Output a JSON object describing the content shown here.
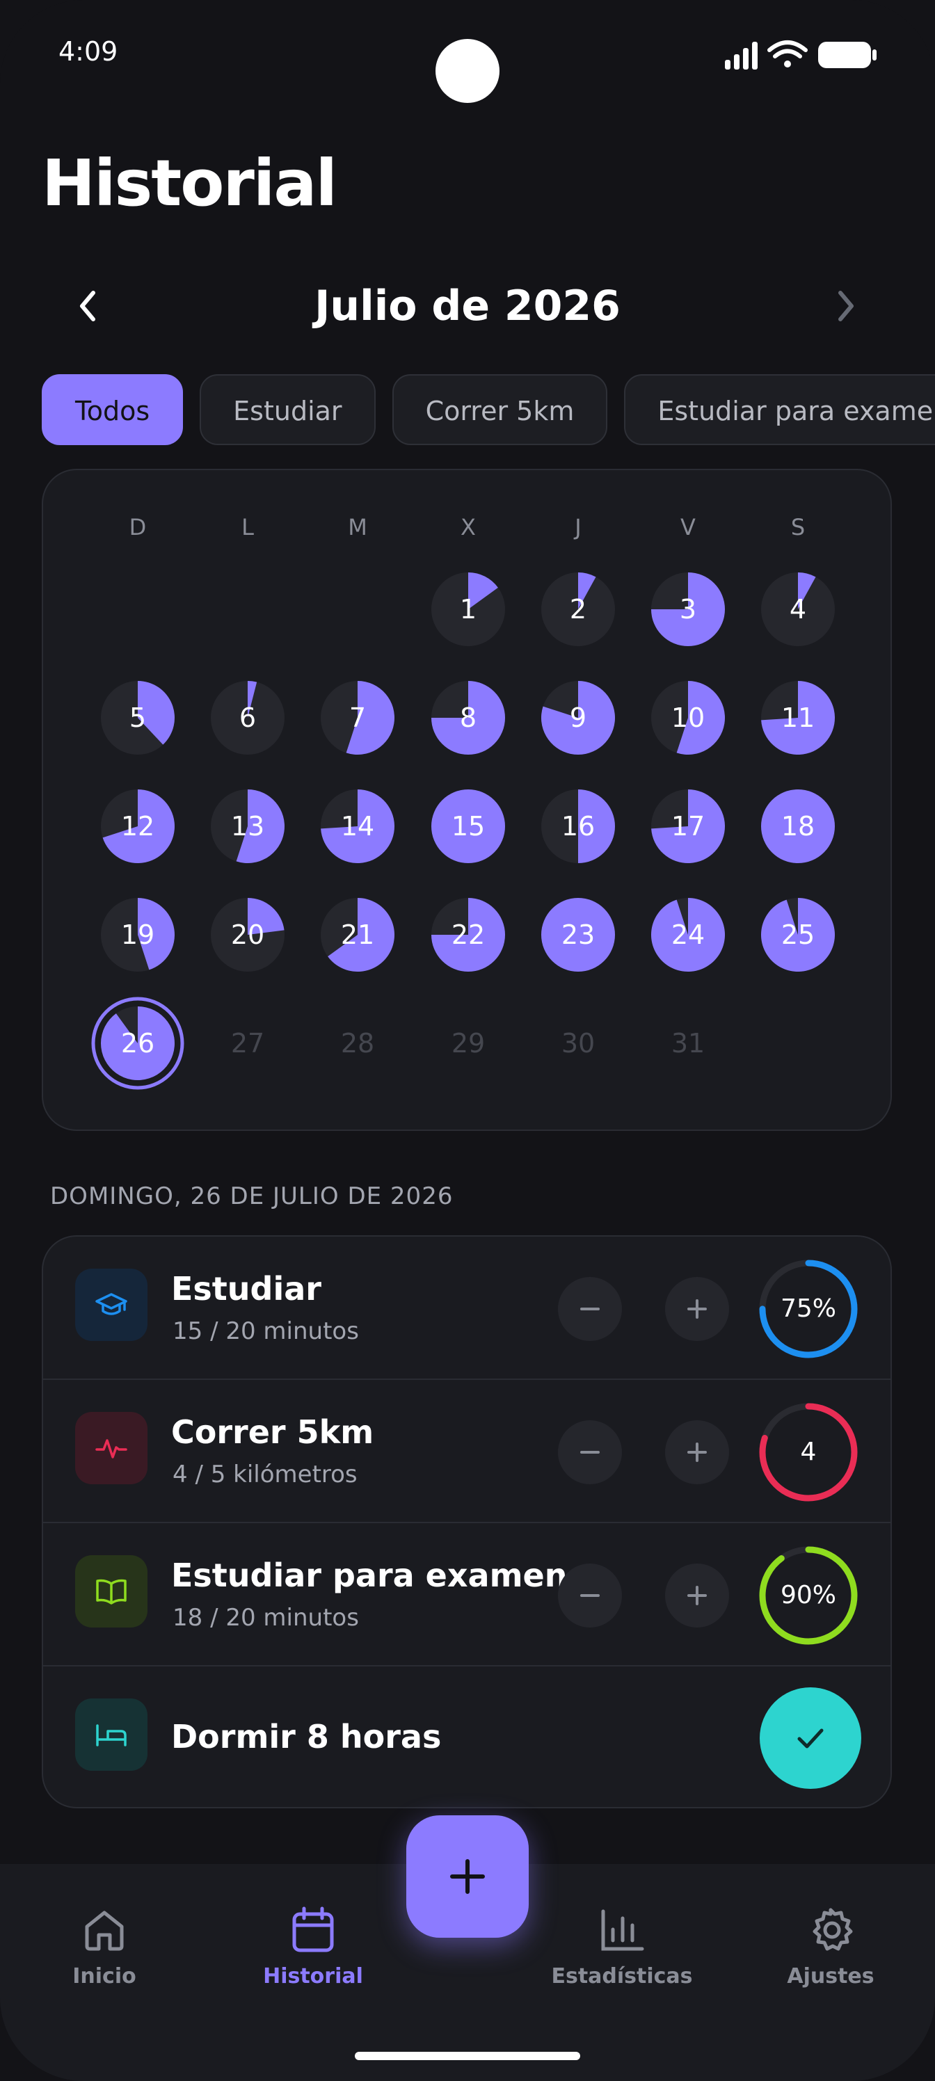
{
  "status_bar": {
    "time": "4:09"
  },
  "page": {
    "title": "Historial"
  },
  "month_nav": {
    "label": "Julio de 2026",
    "prev_icon": "chevron-left-icon",
    "next_icon": "chevron-right-icon"
  },
  "filters": [
    "Todos",
    "Estudiar",
    "Correr 5km",
    "Estudiar para examen"
  ],
  "active_filter": "Todos",
  "calendar": {
    "weekdays": [
      "D",
      "L",
      "M",
      "X",
      "J",
      "V",
      "S"
    ],
    "first_weekday_index": 3,
    "days_in_month": 31,
    "today": 26,
    "accent": "#8c7bff",
    "day_progress": {
      "1": 0.15,
      "2": 0.08,
      "3": 0.75,
      "4": 0.08,
      "5": 0.38,
      "6": 0.04,
      "7": 0.55,
      "8": 0.75,
      "9": 0.8,
      "10": 0.55,
      "11": 0.74,
      "12": 0.7,
      "13": 0.55,
      "14": 0.74,
      "15": 1.0,
      "16": 0.5,
      "17": 0.74,
      "18": 1.0,
      "19": 0.45,
      "20": 0.23,
      "21": 0.65,
      "22": 0.75,
      "23": 1.0,
      "24": 0.95,
      "25": 0.95,
      "26": 0.9
    }
  },
  "selected_date": "DOMINGO, 26 DE JULIO DE 2026",
  "habits": [
    {
      "name": "Estudiar",
      "detail": "15 / 20 minutos",
      "icon": "graduation-cap-icon",
      "color": "#1d8ff0",
      "icon_bg": "#15263a",
      "progress": 0.75,
      "ring_text": "75%",
      "kind": "counter"
    },
    {
      "name": "Correr 5km",
      "detail": "4 / 5 kilómetros",
      "icon": "activity-pulse-icon",
      "color": "#ea2d55",
      "icon_bg": "#3a1a24",
      "progress": 0.8,
      "ring_text": "4",
      "kind": "counter"
    },
    {
      "name": "Estudiar para examen",
      "detail": "18 / 20 minutos",
      "icon": "open-book-icon",
      "color": "#8fdc1f",
      "icon_bg": "#27341a",
      "progress": 0.9,
      "ring_text": "90%",
      "kind": "counter"
    },
    {
      "name": "Dormir 8 horas",
      "detail": "",
      "icon": "bed-icon",
      "color": "#2dd4cf",
      "icon_bg": "#163234",
      "progress": 1.0,
      "ring_text": "",
      "kind": "check"
    }
  ],
  "bottom_nav": [
    {
      "label": "Inicio",
      "icon": "home-icon",
      "active": false
    },
    {
      "label": "Historial",
      "icon": "calendar-icon",
      "active": true
    },
    {
      "label": "Estadísticas",
      "icon": "bar-chart-icon",
      "active": false
    },
    {
      "label": "Ajustes",
      "icon": "gear-icon",
      "active": false
    }
  ],
  "fab": {
    "icon": "plus-icon"
  }
}
